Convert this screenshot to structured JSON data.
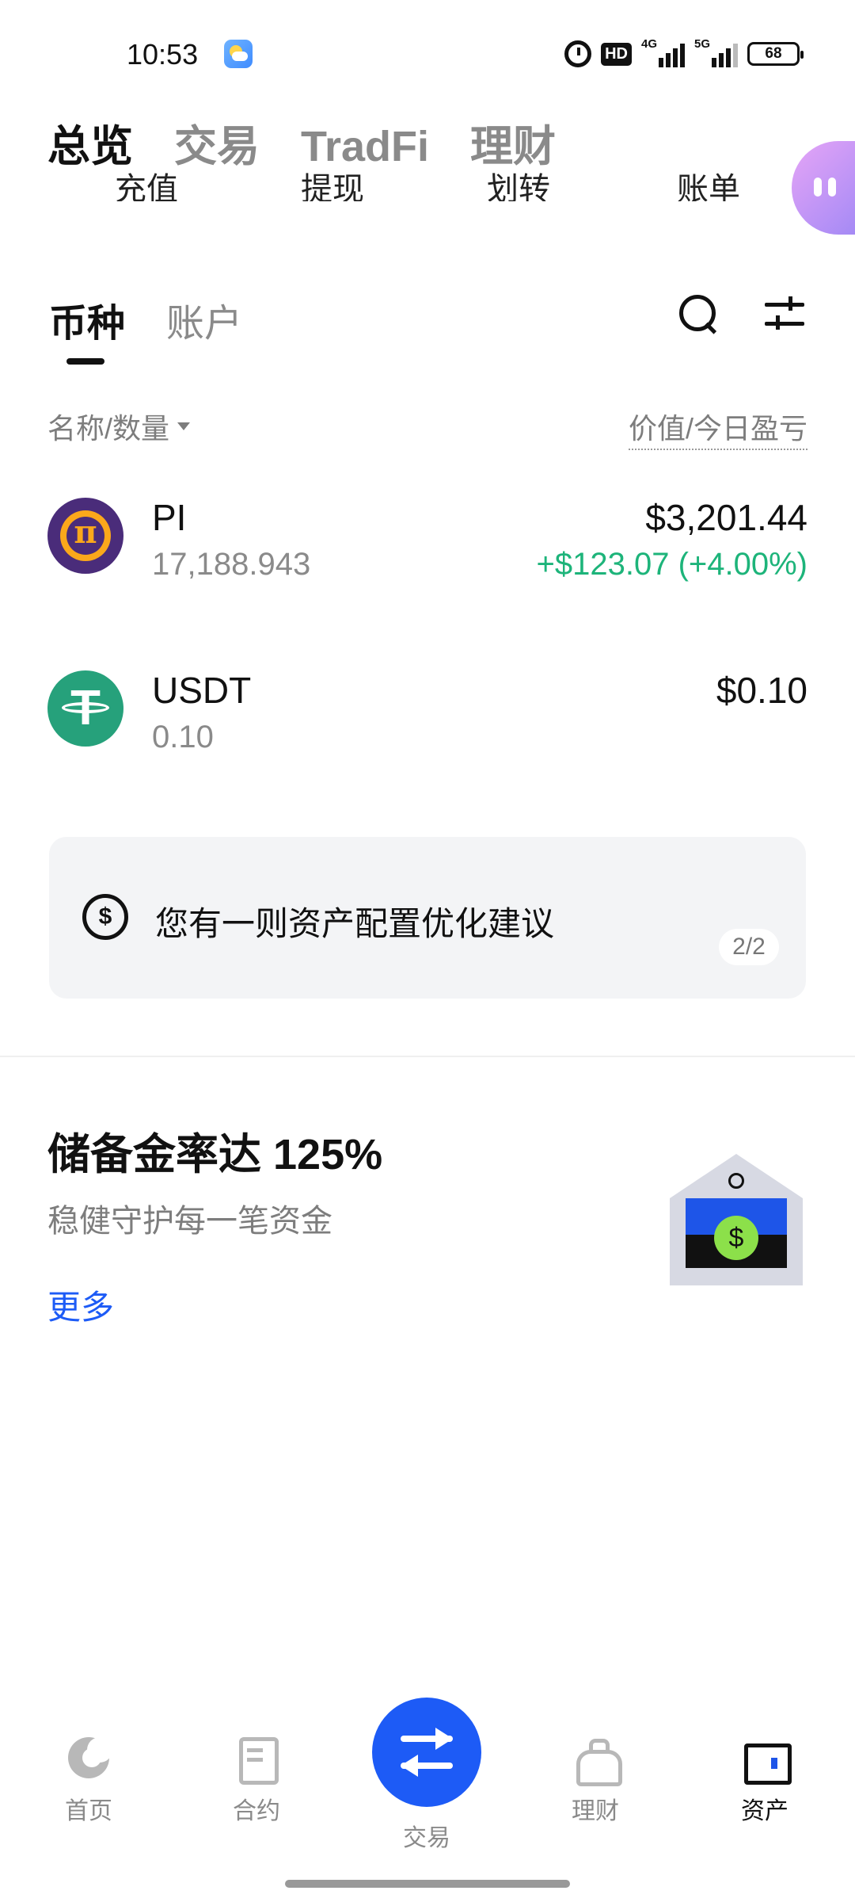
{
  "status_bar": {
    "time": "10:53",
    "network_1": "4G",
    "network_2": "5G",
    "battery": "68",
    "hd_label": "HD"
  },
  "top_tabs": [
    {
      "label": "总览",
      "active": true
    },
    {
      "label": "交易",
      "active": false
    },
    {
      "label": "TradFi",
      "active": false
    },
    {
      "label": "理财",
      "active": false
    }
  ],
  "quick_actions": [
    "充值",
    "提现",
    "划转",
    "账单"
  ],
  "asset_tabs": [
    {
      "label": "币种",
      "active": true
    },
    {
      "label": "账户",
      "active": false
    }
  ],
  "list_header": {
    "left": "名称/数量",
    "right": "价值/今日盈亏"
  },
  "coins": [
    {
      "symbol": "PI",
      "quantity": "17,188.943",
      "value": "$3,201.44",
      "pnl": "+$123.07 (+4.00%)",
      "icon": "pi-coin-icon",
      "pnl_color": "#1db47a"
    },
    {
      "symbol": "USDT",
      "quantity": "0.10",
      "value": "$0.10",
      "pnl": "",
      "icon": "usdt-coin-icon"
    }
  ],
  "suggestion": {
    "text": "您有一则资产配置优化建议",
    "page": "2/2",
    "icon": "dollar-icon"
  },
  "reserve": {
    "title": "储备金率达 125%",
    "subtitle": "稳健守护每一笔资金",
    "more": "更多",
    "icon": "vault-icon"
  },
  "bottom_nav": [
    {
      "label": "首页",
      "icon": "home-icon",
      "active": false
    },
    {
      "label": "合约",
      "icon": "contract-icon",
      "active": false
    },
    {
      "label": "交易",
      "icon": "swap-icon",
      "active": false
    },
    {
      "label": "理财",
      "icon": "earn-icon",
      "active": false
    },
    {
      "label": "资产",
      "icon": "wallet-icon",
      "active": true
    }
  ],
  "colors": {
    "accent": "#1d5bf6",
    "positive": "#1db47a",
    "muted": "#8a8a8a"
  }
}
